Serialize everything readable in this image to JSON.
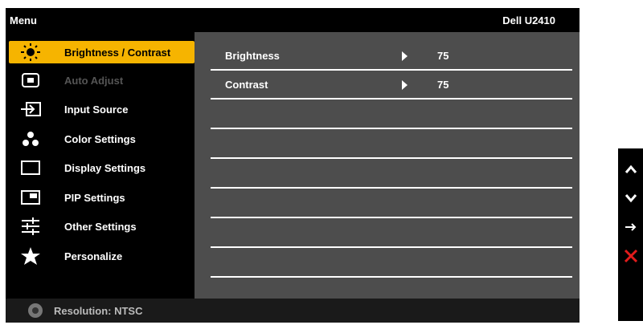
{
  "title_bar": {
    "left": "Menu",
    "right": "Dell U2410"
  },
  "menu": {
    "items": [
      {
        "label": "Brightness / Contrast",
        "icon": "sun-icon",
        "state": "selected"
      },
      {
        "label": "Auto Adjust",
        "icon": "auto-adjust-icon",
        "state": "disabled"
      },
      {
        "label": "Input Source",
        "icon": "input-source-icon",
        "state": "normal"
      },
      {
        "label": "Color Settings",
        "icon": "color-dots-icon",
        "state": "normal"
      },
      {
        "label": "Display Settings",
        "icon": "display-rect-icon",
        "state": "normal"
      },
      {
        "label": "PIP Settings",
        "icon": "pip-icon",
        "state": "normal"
      },
      {
        "label": "Other Settings",
        "icon": "sliders-icon",
        "state": "normal"
      },
      {
        "label": "Personalize",
        "icon": "star-icon",
        "state": "normal"
      }
    ]
  },
  "submenu": {
    "rows": [
      {
        "label": "Brightness",
        "value": "75"
      },
      {
        "label": "Contrast",
        "value": "75"
      },
      {
        "label": "",
        "value": ""
      },
      {
        "label": "",
        "value": ""
      },
      {
        "label": "",
        "value": ""
      },
      {
        "label": "",
        "value": ""
      },
      {
        "label": "",
        "value": ""
      },
      {
        "label": "",
        "value": ""
      }
    ]
  },
  "footer": {
    "text": "Resolution: NTSC"
  },
  "buttons": [
    {
      "name": "up",
      "glyph": "⌃"
    },
    {
      "name": "down",
      "glyph": "⌄"
    },
    {
      "name": "enter",
      "glyph": "→"
    },
    {
      "name": "exit",
      "glyph": "✕"
    }
  ],
  "colors": {
    "selected": "#f6b400",
    "submenu_bg": "#4d4d4d",
    "exit": "#e21b1b"
  }
}
